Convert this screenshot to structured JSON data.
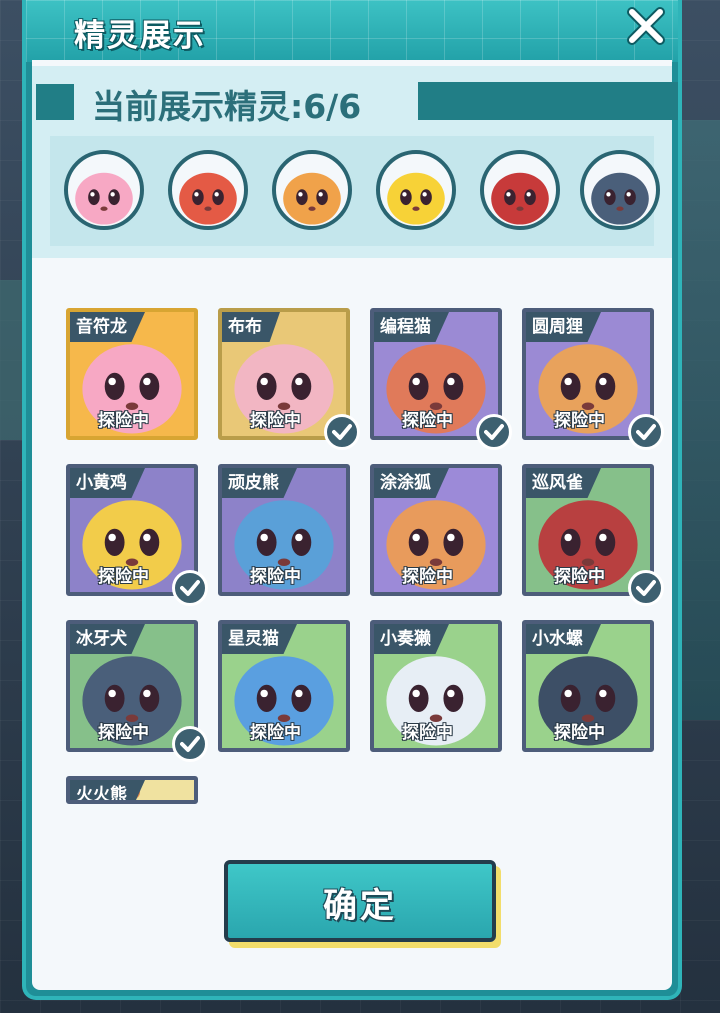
{
  "panel": {
    "title": "精灵展示",
    "close_icon": "close-icon",
    "accent": "#2fb4b9"
  },
  "current": {
    "label": "当前展示精灵:6/6",
    "avatars": [
      {
        "name": "pink-creature-avatar",
        "color": "#f7a8c4"
      },
      {
        "name": "red-fox-avatar",
        "color": "#e45a45"
      },
      {
        "name": "orange-leaf-avatar",
        "color": "#f0a24a"
      },
      {
        "name": "yellow-chick-avatar",
        "color": "#f7d237"
      },
      {
        "name": "red-black-bird-avatar",
        "color": "#c73a3a"
      },
      {
        "name": "dark-dog-avatar",
        "color": "#4a5f7a"
      }
    ]
  },
  "cards": [
    {
      "name": "音符龙",
      "status": "探险中",
      "checked": false,
      "bg": "#f6b84b",
      "border": "#d8a532",
      "tone": "#f7a8c4"
    },
    {
      "name": "布布",
      "status": "探险中",
      "checked": true,
      "bg": "#e9c877",
      "border": "#b99d4a",
      "tone": "#f2b6c3"
    },
    {
      "name": "编程猫",
      "status": "探险中",
      "checked": true,
      "bg": "#9b8ad4",
      "border": "#4d5d7a",
      "tone": "#e07a5a"
    },
    {
      "name": "圆周狸",
      "status": "探险中",
      "checked": true,
      "bg": "#9b8ad4",
      "border": "#4d5d7a",
      "tone": "#e8a25c"
    },
    {
      "name": "小黄鸡",
      "status": "探险中",
      "checked": true,
      "bg": "#8d82c9",
      "border": "#4d5d7a",
      "tone": "#f2cc4a"
    },
    {
      "name": "顽皮熊",
      "status": "探险中",
      "checked": false,
      "bg": "#8d82c9",
      "border": "#4d5d7a",
      "tone": "#5aa0d8"
    },
    {
      "name": "涂涂狐",
      "status": "探险中",
      "checked": false,
      "bg": "#9c8ad8",
      "border": "#4d5d7a",
      "tone": "#e89b5c"
    },
    {
      "name": "巡风雀",
      "status": "探险中",
      "checked": true,
      "bg": "#86c08a",
      "border": "#4d5d7a",
      "tone": "#b84040"
    },
    {
      "name": "冰牙犬",
      "status": "探险中",
      "checked": true,
      "bg": "#86c08a",
      "border": "#4d5d7a",
      "tone": "#4a5f7a"
    },
    {
      "name": "星灵猫",
      "status": "探险中",
      "checked": false,
      "bg": "#9ad28c",
      "border": "#4d5d7a",
      "tone": "#5a9fe0"
    },
    {
      "name": "小奏獭",
      "status": "探险中",
      "checked": false,
      "bg": "#9ad28c",
      "border": "#4d5d7a",
      "tone": "#e7eef5"
    },
    {
      "name": "小水螺",
      "status": "探险中",
      "checked": false,
      "bg": "#9ad28c",
      "border": "#4d5d7a",
      "tone": "#3d4f66"
    },
    {
      "name": "火火熊",
      "status": "",
      "checked": false,
      "bg": "#f0e2a0",
      "border": "#4d5d7a",
      "tone": "#e88a4a"
    }
  ],
  "confirm_label": "确定",
  "check_icon": "check-icon"
}
